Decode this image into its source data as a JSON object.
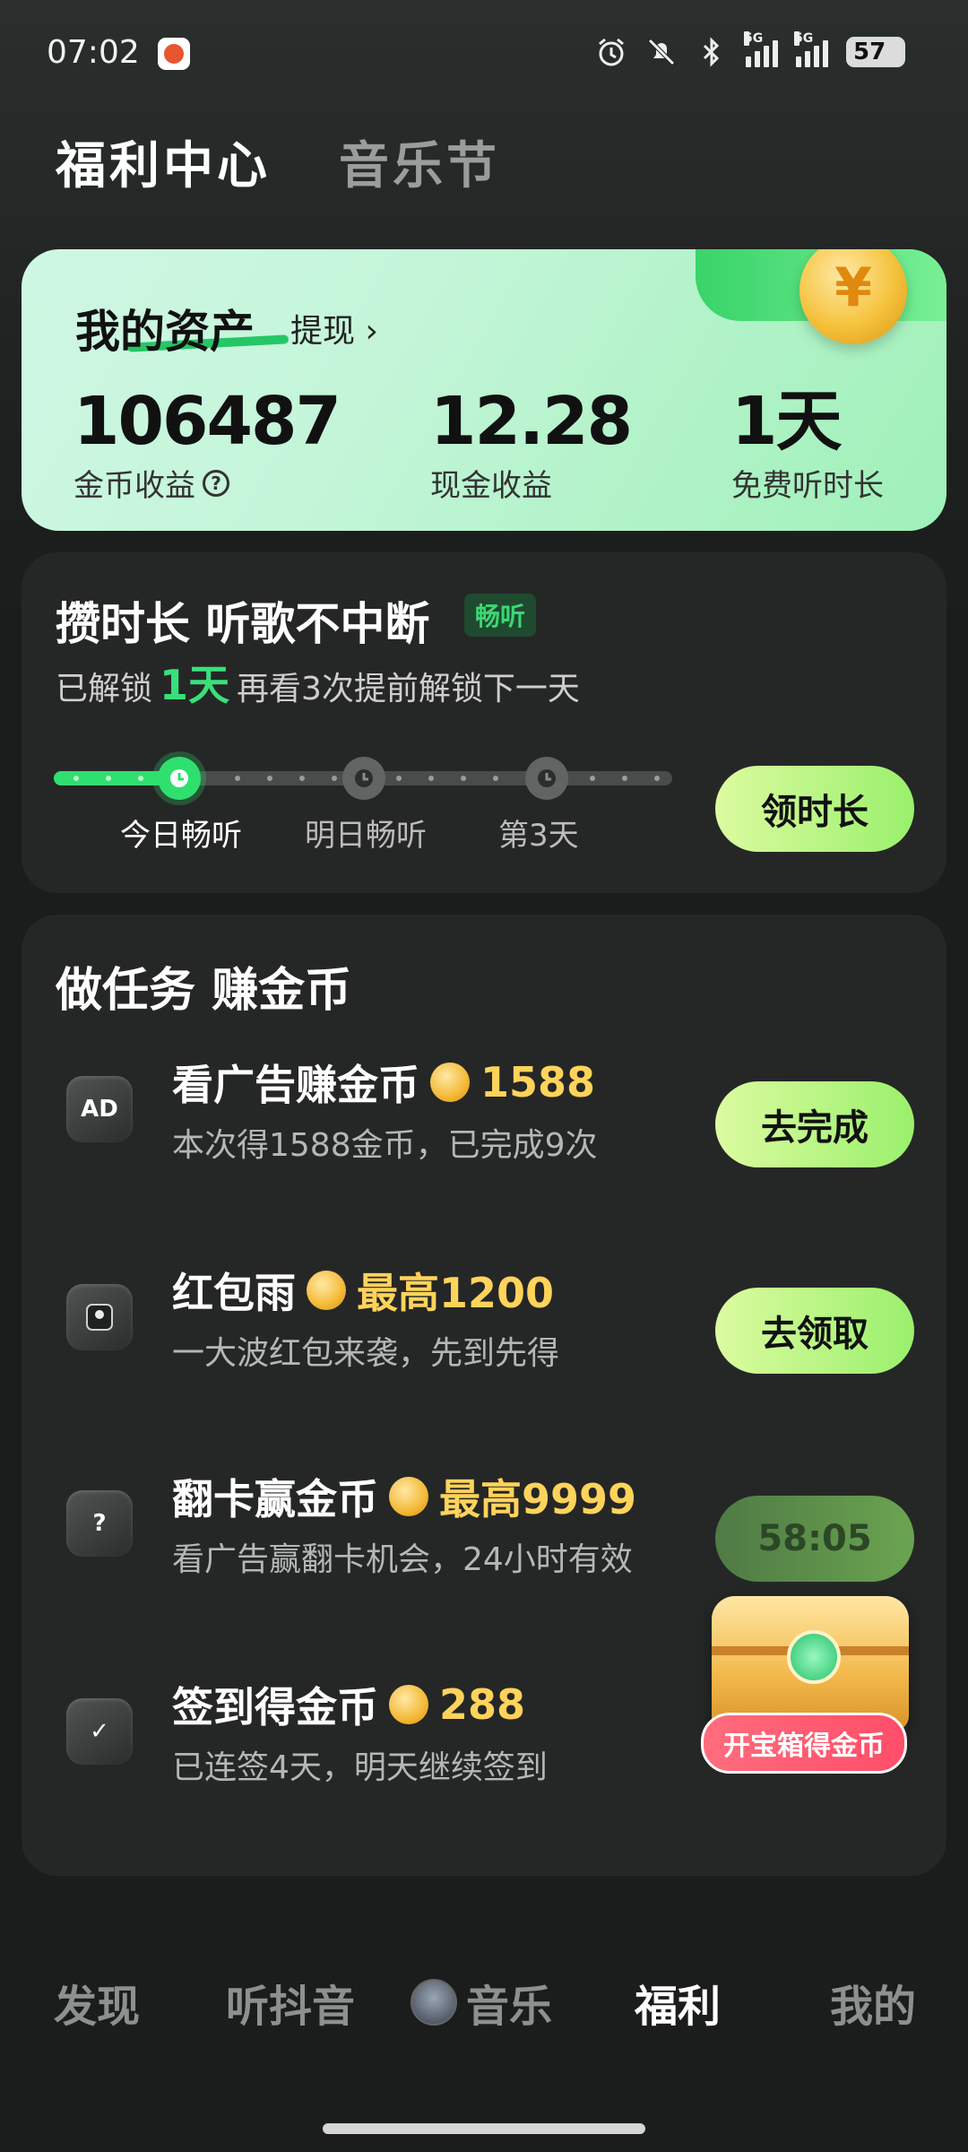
{
  "status_bar": {
    "time": "07:02",
    "battery": "57",
    "icons": [
      "alarm-icon",
      "mute-icon",
      "bluetooth-icon",
      "signal-5g-icon",
      "signal-5g-icon"
    ],
    "network_label": "5G"
  },
  "header": {
    "tabs": [
      {
        "label": "福利中心",
        "active": true
      },
      {
        "label": "音乐节",
        "active": false
      }
    ]
  },
  "assets": {
    "title": "我的资产",
    "withdraw_label": "提现",
    "stats": [
      {
        "value": "106487",
        "label": "金币收益"
      },
      {
        "value": "12.28",
        "label": "现金收益"
      },
      {
        "value": "1天",
        "label": "免费听时长"
      }
    ]
  },
  "listen": {
    "title": "攒时长 听歌不中断",
    "badge": "畅听",
    "sub_prefix": "已解锁",
    "sub_highlight": "1天",
    "sub_suffix": "再看3次提前解锁下一天",
    "progress_labels": [
      "今日畅听",
      "明日畅听",
      "第3天"
    ],
    "progress_fraction": 0.2,
    "button_label": "领时长"
  },
  "tasks": {
    "title": "做任务 赚金币",
    "items": [
      {
        "icon": "ad-icon",
        "icon_text": "AD",
        "name": "看广告赚金币",
        "reward": "1588",
        "desc": "本次得1588金币，已完成9次",
        "button": "去完成",
        "disabled": false
      },
      {
        "icon": "red-packet-icon",
        "icon_text": "",
        "name": "红包雨",
        "reward": "最高1200",
        "desc": "一大波红包来袭，先到先得",
        "button": "去领取",
        "disabled": false
      },
      {
        "icon": "flip-card-icon",
        "icon_text": "?",
        "name": "翻卡赢金币",
        "reward": "最高9999",
        "desc": "看广告赢翻卡机会，24小时有效",
        "button": "58:05",
        "disabled": true
      },
      {
        "icon": "checkin-icon",
        "icon_text": "✓",
        "name": "签到得金币",
        "reward": "288",
        "desc": "已连签4天，明天继续签到",
        "button": "",
        "disabled": false
      }
    ]
  },
  "treasure": {
    "label": "开宝箱得金币"
  },
  "bottom_nav": {
    "items": [
      {
        "label": "发现",
        "active": false
      },
      {
        "label": "听抖音",
        "active": false
      },
      {
        "label": "音乐",
        "active": false
      },
      {
        "label": "福利",
        "active": true
      },
      {
        "label": "我的",
        "active": false
      }
    ]
  },
  "colors": {
    "accent_green": "#2fe06e",
    "reward_gold": "#ffd35b",
    "card_bg": "#252726",
    "page_bg": "#1b1c1c"
  }
}
